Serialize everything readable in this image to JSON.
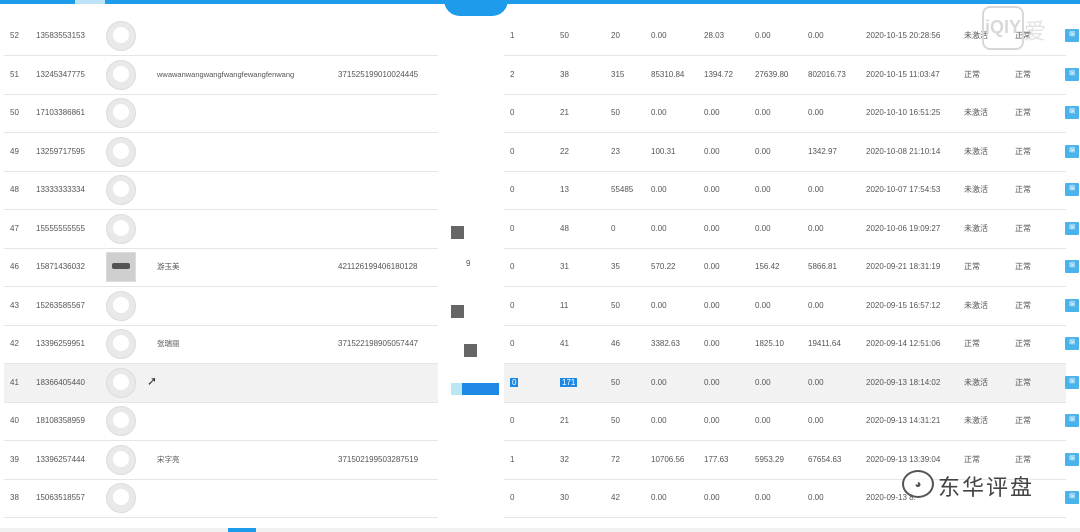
{
  "rows": [
    {
      "id": "52",
      "phone": "13583553153",
      "name": "",
      "idno": "",
      "a": "1",
      "b": "50",
      "c": "20",
      "d": "0.00",
      "e": "28.03",
      "f": "0.00",
      "g": "0.00",
      "time": "2020-10-15 20:28:56",
      "stat1": "未激活",
      "stat2": "正常",
      "edit": "编"
    },
    {
      "id": "51",
      "phone": "13245347775",
      "name": "wwawanwangwangfwangfewangfenwang",
      "idno": "371525199010024445",
      "a": "2",
      "b": "38",
      "c": "315",
      "d": "85310.84",
      "e": "1394.72",
      "f": "27639.80",
      "g": "802016.73",
      "time": "2020-10-15 11:03:47",
      "stat1": "正常",
      "stat2": "正常",
      "edit": "编"
    },
    {
      "id": "50",
      "phone": "17103386861",
      "name": "",
      "idno": "",
      "a": "0",
      "b": "21",
      "c": "50",
      "d": "0.00",
      "e": "0.00",
      "f": "0.00",
      "g": "0.00",
      "time": "2020-10-10 16:51:25",
      "stat1": "未激活",
      "stat2": "正常",
      "edit": "编"
    },
    {
      "id": "49",
      "phone": "13259717595",
      "name": "",
      "idno": "",
      "a": "0",
      "b": "22",
      "c": "23",
      "d": "100.31",
      "e": "0.00",
      "f": "0.00",
      "g": "1342.97",
      "time": "2020-10-08 21:10:14",
      "stat1": "未激活",
      "stat2": "正常",
      "edit": "编"
    },
    {
      "id": "48",
      "phone": "13333333334",
      "name": "",
      "idno": "",
      "a": "0",
      "b": "13",
      "c": "55485",
      "d": "0.00",
      "e": "0.00",
      "f": "0.00",
      "g": "0.00",
      "time": "2020-10-07 17:54:53",
      "stat1": "未激活",
      "stat2": "正常",
      "edit": "编"
    },
    {
      "id": "47",
      "phone": "15555555555",
      "name": "",
      "idno": "",
      "a": "0",
      "b": "48",
      "c": "0",
      "d": "0.00",
      "e": "0.00",
      "f": "0.00",
      "g": "0.00",
      "time": "2020-10-06 19:09:27",
      "stat1": "未激活",
      "stat2": "正常",
      "edit": "编"
    },
    {
      "id": "46",
      "phone": "15871436032",
      "name": "游玉美",
      "idno": "421126199406180128",
      "a": "0",
      "b": "31",
      "c": "35",
      "d": "570.22",
      "e": "0.00",
      "f": "156.42",
      "g": "5866.81",
      "time": "2020-09-21 18:31:19",
      "stat1": "正常",
      "stat2": "正常",
      "edit": "编"
    },
    {
      "id": "43",
      "phone": "15263585567",
      "name": "",
      "idno": "",
      "a": "0",
      "b": "11",
      "c": "50",
      "d": "0.00",
      "e": "0.00",
      "f": "0.00",
      "g": "0.00",
      "time": "2020-09-15 16:57:12",
      "stat1": "未激活",
      "stat2": "正常",
      "edit": "编"
    },
    {
      "id": "42",
      "phone": "13396259951",
      "name": "张瑞丽",
      "idno": "371522198905057447",
      "a": "0",
      "b": "41",
      "c": "46",
      "d": "3382.63",
      "e": "0.00",
      "f": "1825.10",
      "g": "19411.64",
      "time": "2020-09-14 12:51:06",
      "stat1": "正常",
      "stat2": "正常",
      "edit": "编"
    },
    {
      "id": "41",
      "phone": "18366405440",
      "name": "",
      "idno": "",
      "a": "0",
      "b": "171",
      "c": "50",
      "d": "0.00",
      "e": "0.00",
      "f": "0.00",
      "g": "0.00",
      "time": "2020-09-13 18:14:02",
      "stat1": "未激活",
      "stat2": "正常",
      "edit": "编"
    },
    {
      "id": "40",
      "phone": "18108358959",
      "name": "",
      "idno": "",
      "a": "0",
      "b": "21",
      "c": "50",
      "d": "0.00",
      "e": "0.00",
      "f": "0.00",
      "g": "0.00",
      "time": "2020-09-13 14:31:21",
      "stat1": "未激活",
      "stat2": "正常",
      "edit": "编"
    },
    {
      "id": "39",
      "phone": "13396257444",
      "name": "宋字亮",
      "idno": "371502199503287519",
      "a": "1",
      "b": "32",
      "c": "72",
      "d": "10706.56",
      "e": "177.63",
      "f": "5953.29",
      "g": "67654.63",
      "time": "2020-09-13 13:39:04",
      "stat1": "正常",
      "stat2": "正常",
      "edit": "编"
    },
    {
      "id": "38",
      "phone": "15063518557",
      "name": "",
      "idno": "",
      "a": "0",
      "b": "30",
      "c": "42",
      "d": "0.00",
      "e": "0.00",
      "f": "0.00",
      "g": "0.00",
      "time": "2020-09-13 8:",
      "stat1": "",
      "stat2": "",
      "edit": "编"
    }
  ],
  "row46_extra": "9",
  "watermark": {
    "logo": "iQIY",
    "char": "爱",
    "text": "东华评盘"
  },
  "colors": {
    "accent": "#1e9bea",
    "selection": "#1e88e5"
  }
}
